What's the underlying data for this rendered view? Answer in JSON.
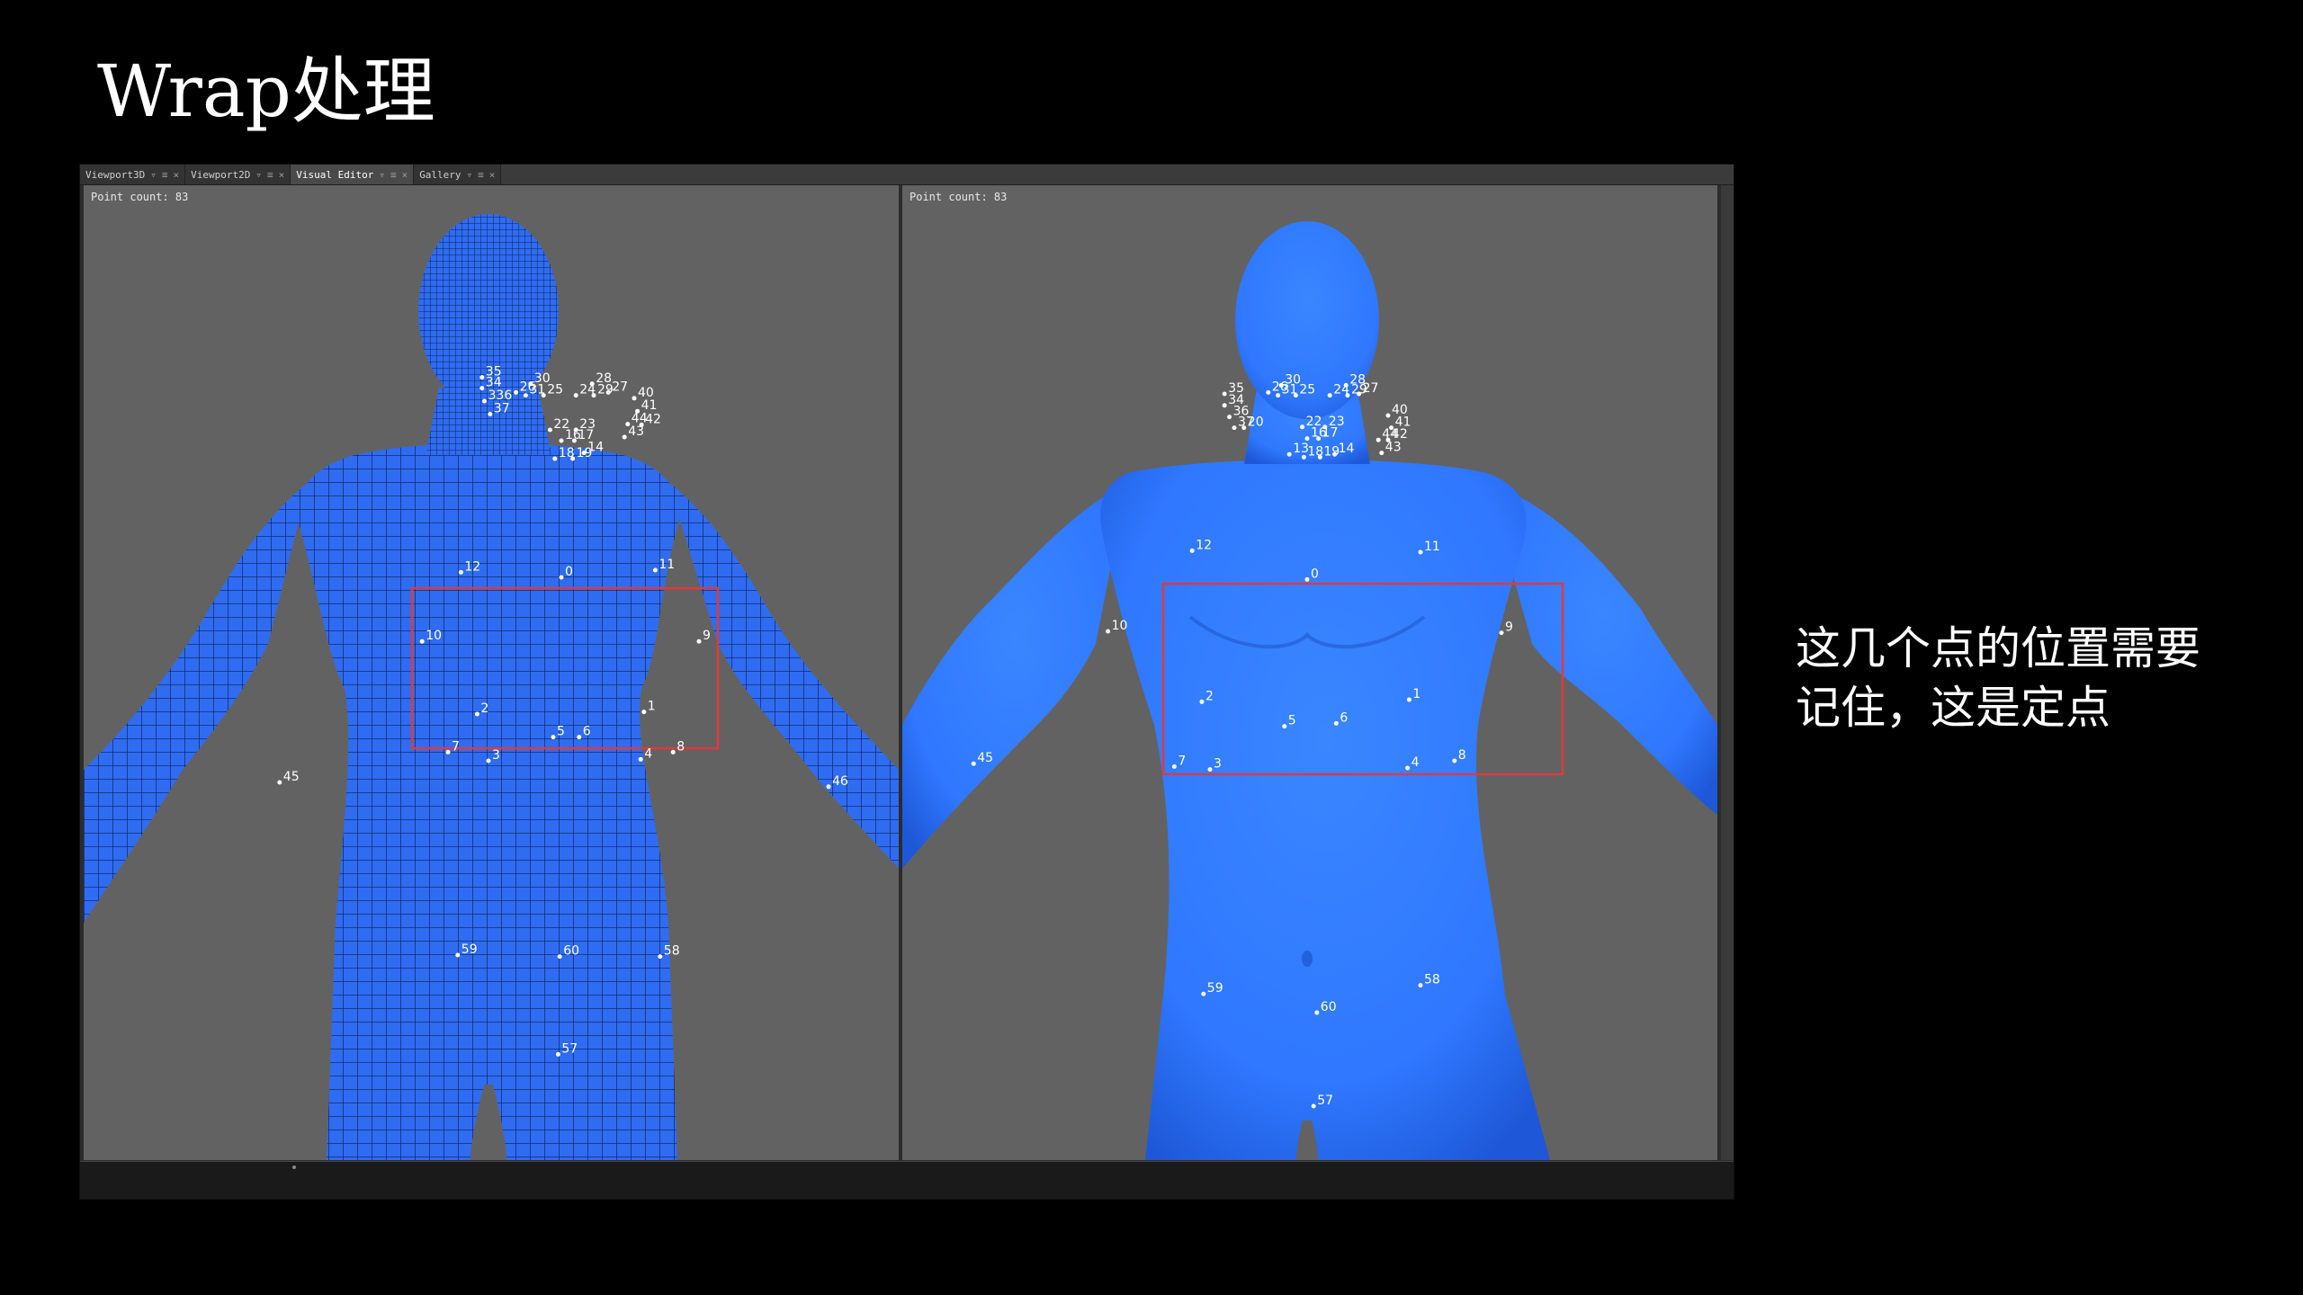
{
  "slide": {
    "title": "Wrap处理",
    "note_lines": [
      "这几个点的位置需要",
      "记住，这是定点"
    ]
  },
  "app": {
    "tabs": [
      {
        "label": "Viewport3D",
        "active": false
      },
      {
        "label": "Viewport2D",
        "active": false
      },
      {
        "label": "Visual Editor",
        "active": true
      },
      {
        "label": "Gallery",
        "active": false
      }
    ],
    "viewports": [
      {
        "id": "left",
        "point_count": "Point count: 83"
      },
      {
        "id": "right",
        "point_count": "Point count: 83"
      }
    ]
  },
  "colors": {
    "background": "#000000",
    "viewport": "#626262",
    "mesh_blue": "#2f6cf2",
    "scan_blue": "#2f78ff",
    "highlight_box": "#e03a3a"
  },
  "icons": {
    "tab_pin": "pin-icon",
    "tab_menu": "menu-icon",
    "tab_close": "close-icon"
  },
  "markers": {
    "left": [
      "35",
      "34",
      "336",
      "37",
      "26",
      "30",
      "31",
      "25",
      "24",
      "28",
      "29",
      "27",
      "40",
      "41",
      "44",
      "42",
      "43",
      "22",
      "23",
      "16",
      "17",
      "18",
      "19",
      "14",
      "12",
      "0",
      "11",
      "10",
      "9",
      "2",
      "1",
      "5",
      "6",
      "7",
      "3",
      "4",
      "8",
      "45",
      "46",
      "59",
      "60",
      "58",
      "57"
    ],
    "right": [
      "35",
      "34",
      "36",
      "37",
      "20",
      "26",
      "30",
      "31",
      "25",
      "24",
      "28",
      "29",
      "27",
      "40",
      "41",
      "44",
      "42",
      "43",
      "22",
      "23",
      "16",
      "17",
      "13",
      "18",
      "19",
      "14",
      "12",
      "11",
      "0",
      "10",
      "9",
      "2",
      "1",
      "5",
      "6",
      "7",
      "3",
      "4",
      "8",
      "45",
      "59",
      "60",
      "58",
      "57"
    ]
  }
}
